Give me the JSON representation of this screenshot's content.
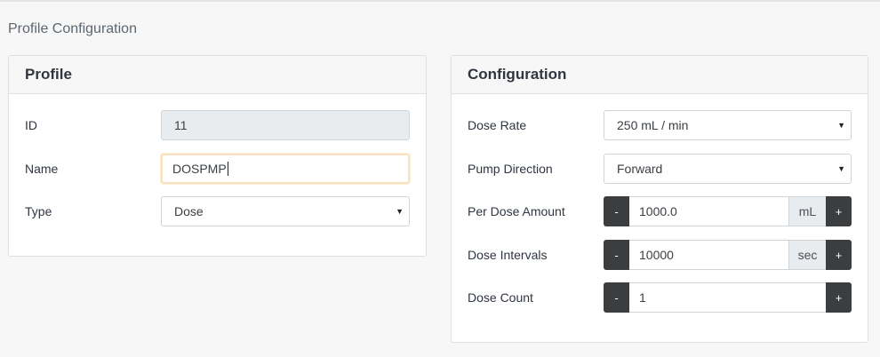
{
  "page": {
    "title": "Profile Configuration"
  },
  "profile": {
    "header": "Profile",
    "id_label": "ID",
    "id_value": "11",
    "name_label": "Name",
    "name_value": "DOSPMP",
    "type_label": "Type",
    "type_value": "Dose"
  },
  "configuration": {
    "header": "Configuration",
    "dose_rate_label": "Dose Rate",
    "dose_rate_value": "250 mL / min",
    "pump_direction_label": "Pump Direction",
    "pump_direction_value": "Forward",
    "per_dose_amount_label": "Per Dose Amount",
    "per_dose_amount_value": "1000.0",
    "per_dose_amount_unit": "mL",
    "dose_intervals_label": "Dose Intervals",
    "dose_intervals_value": "10000",
    "dose_intervals_unit": "sec",
    "dose_count_label": "Dose Count",
    "dose_count_value": "1",
    "minus_label": "-",
    "plus_label": "+"
  },
  "icons": {
    "dropdown": "caret-down-icon"
  },
  "colors": {
    "stepper_button": "#3c3d3e",
    "focus_border": "#fbe1bf",
    "readonly_bg": "#e9ecef"
  }
}
